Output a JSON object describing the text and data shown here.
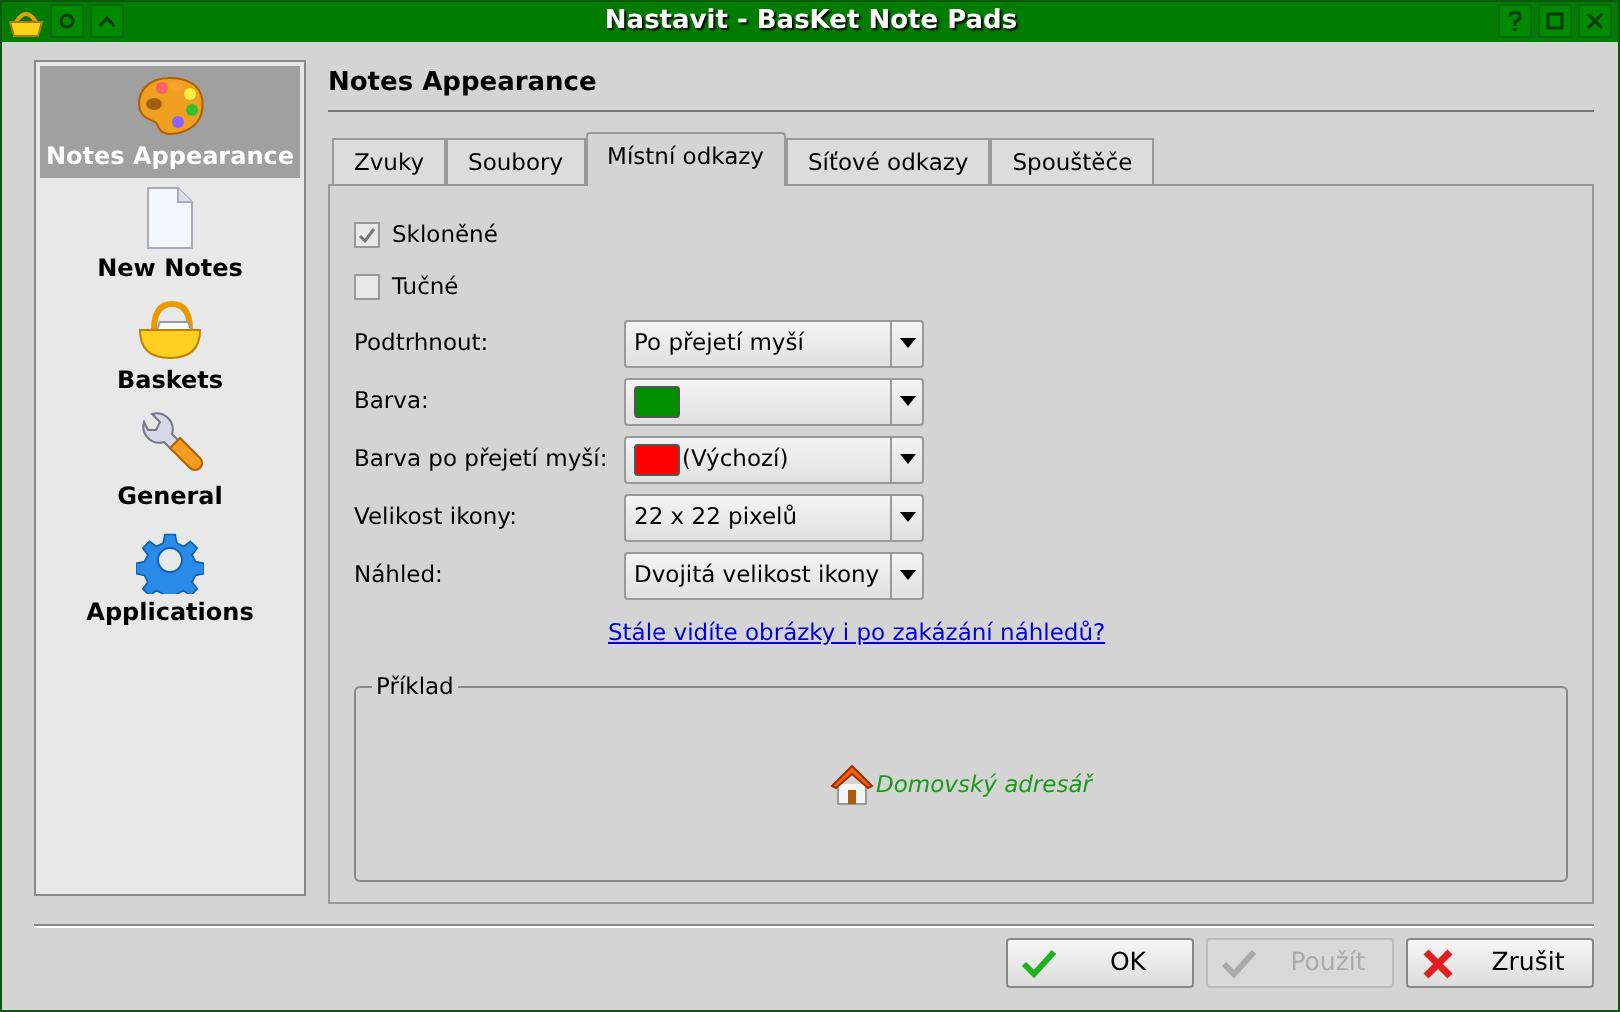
{
  "window": {
    "title": "Nastavit - BasKet Note Pads"
  },
  "sidebar": {
    "items": [
      {
        "label": "Notes Appearance",
        "kind": "palette",
        "selected": true
      },
      {
        "label": "New Notes",
        "kind": "page",
        "selected": false
      },
      {
        "label": "Baskets",
        "kind": "basket",
        "selected": false
      },
      {
        "label": "General",
        "kind": "wrench",
        "selected": false
      },
      {
        "label": "Applications",
        "kind": "gear",
        "selected": false
      }
    ]
  },
  "page_title": "Notes Appearance",
  "tabs": [
    {
      "label": "Zvuky",
      "selected": false
    },
    {
      "label": "Soubory",
      "selected": false
    },
    {
      "label": "Místní odkazy",
      "selected": true
    },
    {
      "label": "Síťové odkazy",
      "selected": false
    },
    {
      "label": "Spouštěče",
      "selected": false
    }
  ],
  "options": [
    {
      "kind": "checkbox",
      "label": "Skloněné",
      "checked": true
    },
    {
      "kind": "checkbox",
      "label": "Tučné",
      "checked": false
    },
    {
      "kind": "combo",
      "label": "Podtrhnout:",
      "value": "Po přejetí myší"
    },
    {
      "kind": "combo",
      "label": "Barva:",
      "color": "#009000"
    },
    {
      "kind": "combo",
      "label": "Barva po přejetí myší:",
      "color": "#ff0000",
      "value": "(Výchozí)"
    },
    {
      "kind": "combo",
      "label": "Velikost ikony:",
      "value": "22 x 22 pixelů"
    },
    {
      "kind": "combo",
      "label": "Náhled:",
      "value": "Dvojitá velikost ikony"
    }
  ],
  "help_link": "Stále vidíte obrázky i po zakázání náhledů?",
  "example": {
    "title": "Příklad",
    "link": "Domovský adresář"
  },
  "buttons": [
    {
      "label": "OK",
      "kind": "ok",
      "disabled": false
    },
    {
      "label": "Použít",
      "kind": "apply",
      "disabled": true
    },
    {
      "label": "Zrušit",
      "kind": "cancel",
      "disabled": false
    }
  ]
}
